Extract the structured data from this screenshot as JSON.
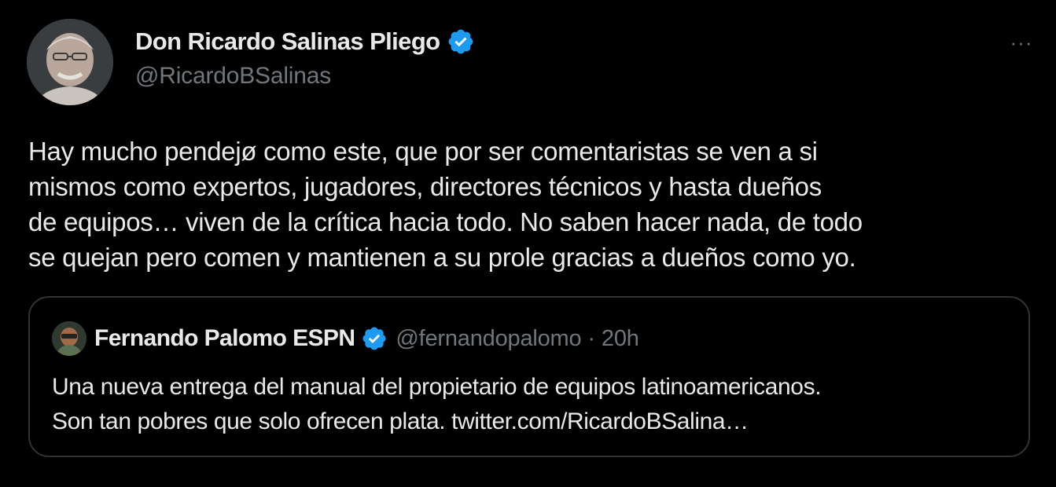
{
  "author": {
    "name": "Don Ricardo Salinas Pliego",
    "handle": "@RicardoBSalinas",
    "verified": true,
    "avatar_icon": "avatar-photo"
  },
  "more_menu": {
    "label": "···",
    "icon": "more-options-icon"
  },
  "tweet": {
    "lines": [
      "Hay mucho pendejø como este, que por ser comentaristas se ven a si",
      "mismos como expertos, jugadores, directores técnicos y hasta dueños",
      "de equipos… viven de la crítica hacia todo. No saben hacer nada, de todo",
      "se quejan pero comen y mantienen a su prole gracias a dueños como yo."
    ]
  },
  "quoted_tweet": {
    "name": "Fernando Palomo ESPN",
    "verified": true,
    "handle": "@fernandopalomo",
    "separator": "·",
    "time": "20h",
    "lines": [
      "Una nueva entrega del manual del propietario de equipos latinoamericanos.",
      "Son tan pobres que solo ofrecen plata. "
    ],
    "link": "twitter.com/RicardoBSalina…"
  },
  "colors": {
    "background": "#000000",
    "text_primary": "#e7e9ea",
    "text_secondary": "#71767b",
    "verified_blue": "#1d9bf0",
    "border": "#2f3336"
  }
}
